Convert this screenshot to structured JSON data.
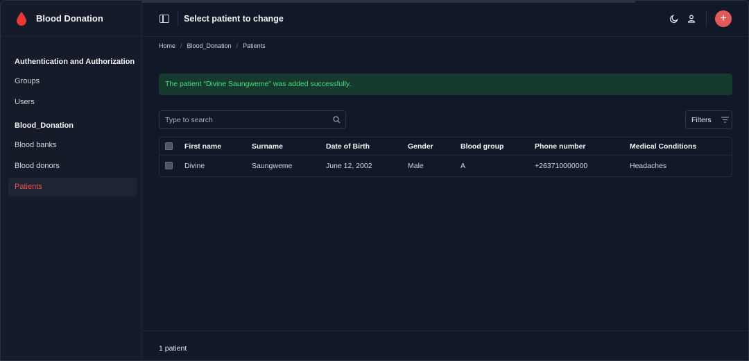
{
  "brand": {
    "title": "Blood Donation",
    "accent": "#e53935"
  },
  "header": {
    "title": "Select patient to change"
  },
  "sidebar": {
    "sections": [
      {
        "title": "Authentication and Authorization",
        "items": [
          "Groups",
          "Users"
        ]
      },
      {
        "title": "Blood_Donation",
        "items": [
          "Blood banks",
          "Blood donors",
          "Patients"
        ]
      }
    ],
    "active_item": "Patients"
  },
  "breadcrumb": [
    "Home",
    "Blood_Donation",
    "Patients"
  ],
  "breadcrumb_separator": "/",
  "alert": {
    "message": "The patient “Divine Saungweme” was added successfully.",
    "color": "#4ade80"
  },
  "search": {
    "placeholder": "Type to search",
    "value": ""
  },
  "filters": {
    "label": "Filters"
  },
  "table": {
    "columns": [
      "First name",
      "Surname",
      "Date of Birth",
      "Gender",
      "Blood group",
      "Phone number",
      "Medical Conditions"
    ],
    "rows": [
      [
        "Divine",
        "Saungweme",
        "June 12, 2002",
        "Male",
        "A",
        "+263710000000",
        "Headaches"
      ]
    ]
  },
  "footer": {
    "count": "1 patient"
  },
  "icons": {
    "brand": "blood-drop-icon",
    "toggle": "sidebar-toggle-icon",
    "theme": "moon-icon",
    "user": "user-icon",
    "add": "plus-icon",
    "search": "search-icon",
    "filter": "filter-icon"
  },
  "add_button": {
    "symbol": "+",
    "color": "#e15a5a"
  }
}
